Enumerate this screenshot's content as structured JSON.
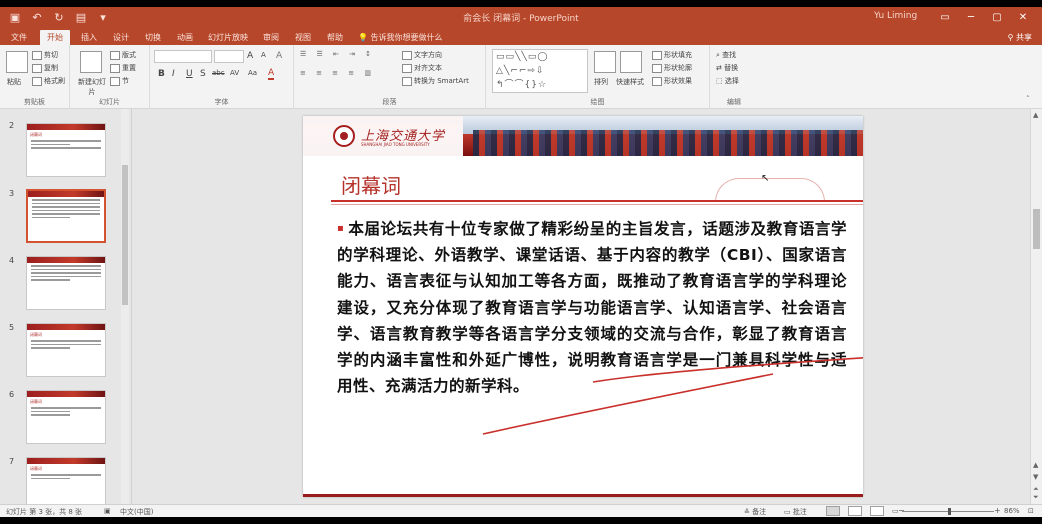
{
  "window": {
    "title": "俞会长 闭幕词 - PowerPoint",
    "user": "Yu Liming",
    "controls": [
      "─",
      "▢",
      "✕"
    ]
  },
  "ribbon_tabs": [
    {
      "label": "文件"
    },
    {
      "label": "开始"
    },
    {
      "label": "插入"
    },
    {
      "label": "设计"
    },
    {
      "label": "切换"
    },
    {
      "label": "动画"
    },
    {
      "label": "幻灯片放映"
    },
    {
      "label": "审阅"
    },
    {
      "label": "视图"
    },
    {
      "label": "帮助"
    }
  ],
  "tell_me": "告诉我你想要做什么",
  "share": "共享",
  "ribbon": {
    "clipboard": {
      "paste": "粘贴",
      "cut": "剪切",
      "copy": "复制",
      "format_painter": "格式刷",
      "label": "剪贴板"
    },
    "slides": {
      "new_slide": "新建幻灯片",
      "layout": "版式",
      "reset": "重置",
      "section": "节",
      "label": "幻灯片"
    },
    "font": {
      "label": "字体",
      "size_up": "A",
      "size_down": "A",
      "clear": "A",
      "bold": "B",
      "italic": "I",
      "underline": "U",
      "shadow": "S",
      "strike": "abc",
      "spacing": "AV",
      "case": "Aa",
      "color": "A"
    },
    "paragraph": {
      "label": "段落",
      "text_direction": "文字方向",
      "align_text": "对齐文本",
      "smartart": "转换为 SmartArt"
    },
    "drawing": {
      "label": "绘图",
      "arrange": "排列",
      "quick_styles": "快速样式",
      "shape_fill": "形状填充",
      "shape_outline": "形状轮廓",
      "shape_effects": "形状效果"
    },
    "editing": {
      "label": "编辑",
      "find": "查找",
      "replace": "替换",
      "select": "选择"
    }
  },
  "thumbnails": [
    {
      "number": "2",
      "title": "闭幕词"
    },
    {
      "number": "3",
      "title": "",
      "selected": true
    },
    {
      "number": "4",
      "title": ""
    },
    {
      "number": "5",
      "title": "闭幕词"
    },
    {
      "number": "6",
      "title": "闭幕词"
    },
    {
      "number": "7",
      "title": "闭幕词"
    }
  ],
  "slide": {
    "logo_text": "上海交通大学",
    "logo_sub": "SHANGHAI JIAO TONG UNIVERSITY",
    "heading": "闭幕词",
    "bullet": "▪",
    "body": "本届论坛共有十位专家做了精彩纷呈的主旨发言，话题涉及教育语言学的学科理论、外语教学、课堂话语、基于内容的教学（CBI）、国家语言能力、语言表征与认知加工等各方面，既推动了教育语言学的学科理论建设，又充分体现了教育语言学与功能语言学、认知语言学、社会语言学、语言教育教学等各语言学分支领域的交流与合作，彰显了教育语言学的内涵丰富性和外延广博性，说明教育语言学是一门兼具科学性与适用性、充满活力的新学科。"
  },
  "status": {
    "slide_info": "幻灯片 第 3 张，共 8 张",
    "language": "中文(中国)",
    "notes": "备注",
    "comments": "批注",
    "zoom": "86%"
  },
  "colors": {
    "accent": "#b7472a",
    "slide_red": "#c9302c"
  }
}
